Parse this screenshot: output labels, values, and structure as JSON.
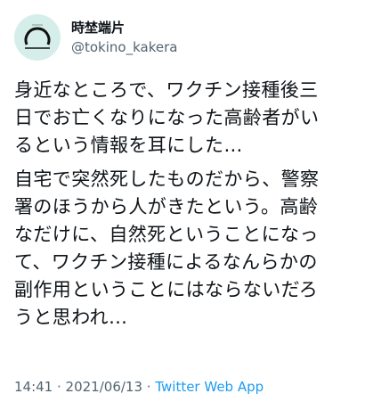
{
  "user": {
    "display_name": "時埜端片",
    "handle": "@tokino_kakera",
    "avatar_icon": "circle-ring-avatar",
    "avatar_bg": "#d6eee9"
  },
  "tweet": {
    "paragraphs": [
      "身近なところで、ワクチン接種後三\n日でお亡くなりになった高齢者がい\nるという情報を耳にした…",
      "自宅で突然死したものだから、警察\n署のほうから人がきたという。高齢\nなだけに、自然死ということになっ\nて、ワクチン接種によるなんらかの\n副作用ということにはならないだろ\nうと思われ…"
    ]
  },
  "meta": {
    "time": "14:41",
    "separator1": " · ",
    "date": "2021/06/13",
    "separator2": " · ",
    "source": "Twitter Web App"
  },
  "colors": {
    "text": "#0f1419",
    "secondary": "#536471",
    "link": "#1d9bf0"
  }
}
